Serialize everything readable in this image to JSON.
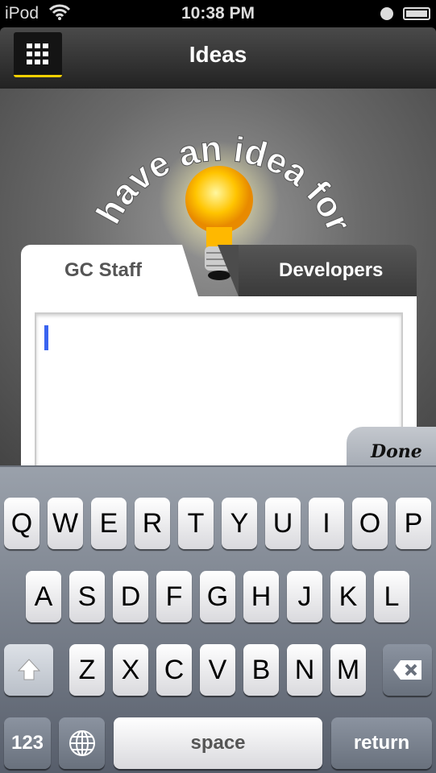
{
  "status": {
    "carrier": "iPod",
    "time": "10:38 PM"
  },
  "nav": {
    "title": "Ideas",
    "menu_icon": "grid-icon",
    "accent": "#f2d000"
  },
  "hero": {
    "arc_text": "I have an idea for:",
    "icon": "lightbulb-icon"
  },
  "tabs": [
    {
      "label": "GC Staff",
      "selected": true
    },
    {
      "label": "Developers",
      "selected": false
    }
  ],
  "editor": {
    "value": "",
    "cursor_color": "#3a64f0"
  },
  "done_label": "Done",
  "keyboard": {
    "row1": [
      "Q",
      "W",
      "E",
      "R",
      "T",
      "Y",
      "U",
      "I",
      "O",
      "P"
    ],
    "row2": [
      "A",
      "S",
      "D",
      "F",
      "G",
      "H",
      "J",
      "K",
      "L"
    ],
    "row3": [
      "Z",
      "X",
      "C",
      "V",
      "B",
      "N",
      "M"
    ],
    "numbers": "123",
    "space": "space",
    "return": "return"
  }
}
